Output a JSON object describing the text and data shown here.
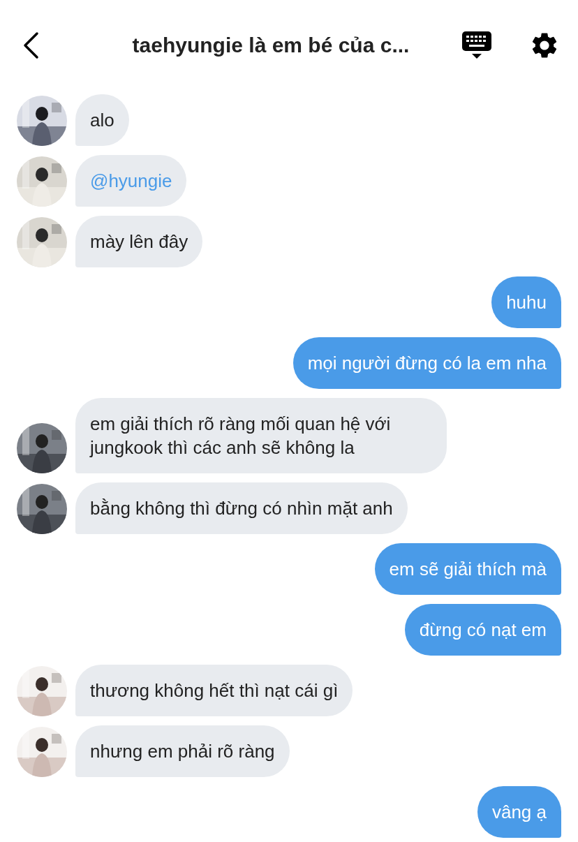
{
  "header": {
    "title": "taehyungie là em bé của c..."
  },
  "messages": [
    {
      "kind": "received",
      "mention": false,
      "text": "alo"
    },
    {
      "kind": "received",
      "mention": true,
      "text": "@hyungie"
    },
    {
      "kind": "received",
      "mention": false,
      "text": "mày lên đây"
    },
    {
      "kind": "sent",
      "mention": false,
      "text": "huhu"
    },
    {
      "kind": "sent",
      "mention": false,
      "text": "mọi người đừng có la em nha"
    },
    {
      "kind": "received",
      "mention": false,
      "text": "em giải thích rõ ràng mối quan hệ với jungkook thì các anh sẽ không la"
    },
    {
      "kind": "received",
      "mention": false,
      "text": "bằng không thì đừng có nhìn mặt anh"
    },
    {
      "kind": "sent",
      "mention": false,
      "text": "em sẽ giải thích mà"
    },
    {
      "kind": "sent",
      "mention": false,
      "text": "đừng có nạt em"
    },
    {
      "kind": "received",
      "mention": false,
      "text": "thương không hết thì nạt cái gì"
    },
    {
      "kind": "received",
      "mention": false,
      "text": "nhưng em phải rõ ràng"
    },
    {
      "kind": "sent",
      "mention": false,
      "text": "vâng ạ"
    }
  ]
}
